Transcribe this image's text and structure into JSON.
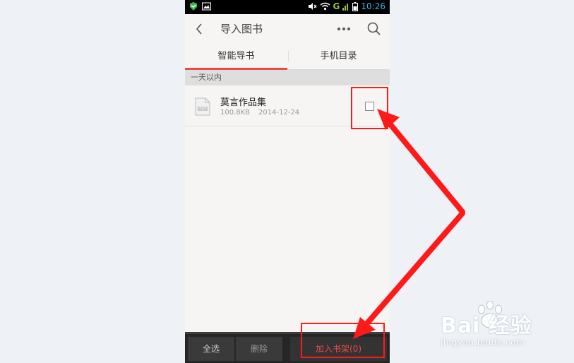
{
  "status_bar": {
    "time": "10:26",
    "signal_label": "G"
  },
  "toolbar": {
    "title": "导入图书"
  },
  "tabs": [
    {
      "label": "智能导书",
      "active": true
    },
    {
      "label": "手机目录",
      "active": false
    }
  ],
  "section": {
    "header": "一天以内"
  },
  "files": [
    {
      "name": "莫言作品集",
      "size": "100.8KB",
      "date": "2014-12-24",
      "checked": false
    }
  ],
  "bottom_bar": {
    "select_all_label": "全选",
    "delete_label": "删除",
    "add_label": "加入书架(0)"
  },
  "colors": {
    "accent": "#e94b4b",
    "annotation": "#ff1a1a",
    "status_time": "#33b5e5"
  },
  "watermark": {
    "brand": "Bai 经验",
    "url": "jingyan.baidu.com"
  }
}
